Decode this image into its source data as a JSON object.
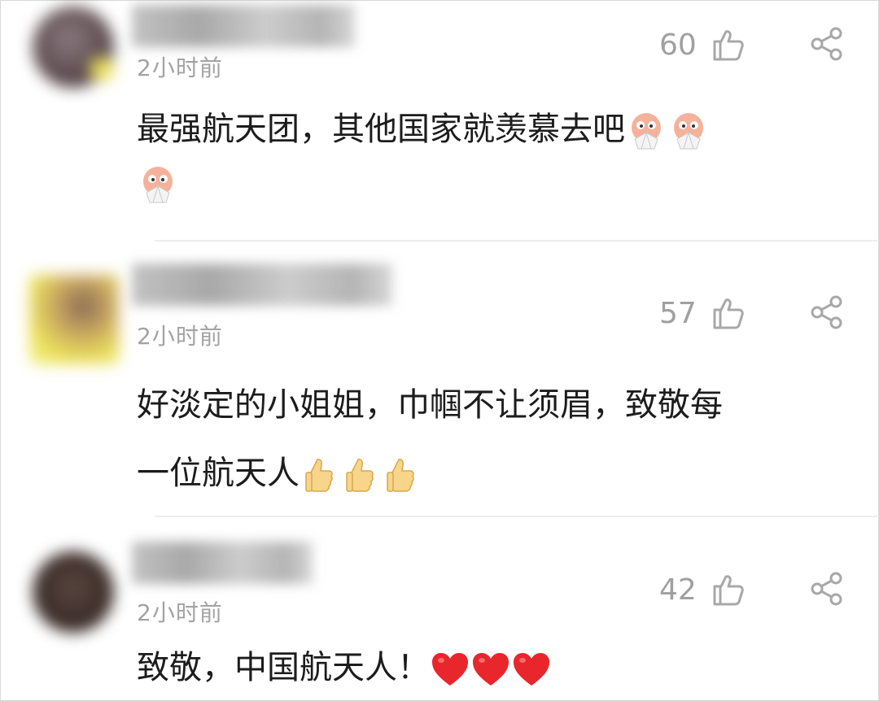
{
  "comments": [
    {
      "time": "2小时前",
      "likes": "60",
      "text": "最强航天团，其他国家就羡慕去吧",
      "emoji": "fan-face-emoji",
      "emoji_count": 3,
      "avatar_color": "#6e5a5e"
    },
    {
      "time": "2小时前",
      "likes": "57",
      "text_line1": "好淡定的小姐姐，巾帼不让须眉，致敬每",
      "text_line2": "一位航天人",
      "emoji": "thumbs-up-emoji",
      "emoji_count": 3,
      "avatar_color": "#e6d24a"
    },
    {
      "time": "2小时前",
      "likes": "42",
      "text": "致敬，中国航天人！",
      "emoji": "red-heart-emoji",
      "emoji_count": 3,
      "avatar_color": "#4a3a36"
    }
  ],
  "icons": {
    "like": "thumbs-up-outline-icon",
    "share": "share-icon"
  },
  "colors": {
    "meta_gray": "#a0a0a0",
    "text": "#1c1c1c",
    "heart": "#e8262c"
  }
}
